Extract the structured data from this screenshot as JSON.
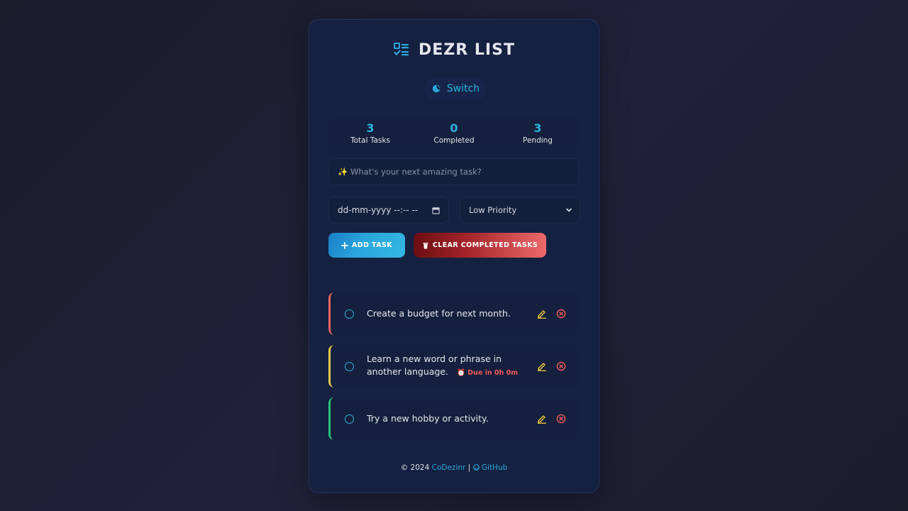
{
  "header": {
    "title": "DEZR LIST",
    "logo_icon": "checklist-icon"
  },
  "theme_switch": {
    "label": "Switch",
    "icon": "moon-icon"
  },
  "stats": [
    {
      "value": "3",
      "label": "Total Tasks"
    },
    {
      "value": "0",
      "label": "Completed"
    },
    {
      "value": "3",
      "label": "Pending"
    }
  ],
  "form": {
    "task_placeholder": "✨ What's your next amazing task?",
    "date_placeholder": "dd-mm-yyyy --:-- --",
    "priority_selected": "Low Priority",
    "add_label": "ADD TASK",
    "clear_label": "CLEAR COMPLETED TASKS"
  },
  "tasks": [
    {
      "text": "Create a budget for next month.",
      "due": "",
      "priority": "high"
    },
    {
      "text": "Learn a new word or phrase in another language.",
      "due": "Due in 0h 0m",
      "priority": "medium"
    },
    {
      "text": "Try a new hobby or activity.",
      "due": "",
      "priority": "low"
    }
  ],
  "footer": {
    "copyright": "© 2024",
    "author": "CoDezinr",
    "separator": "|",
    "github": "GitHub"
  },
  "colors": {
    "accent": "#2cb2df",
    "high": "#e86464",
    "medium": "#e8c84a",
    "low": "#2ec27e",
    "edit": "#f0c63a",
    "delete": "#ef5a5a"
  }
}
